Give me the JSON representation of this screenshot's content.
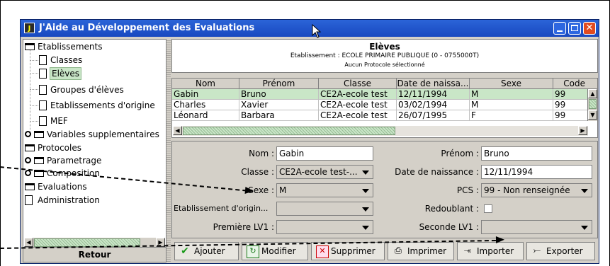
{
  "window": {
    "title": "J'Aide au Développement des Evaluations",
    "app_icon_glyph": "J"
  },
  "tree": {
    "items": [
      {
        "label": "Etablissements",
        "icon": "folder-icon"
      },
      {
        "label": "Classes",
        "icon": "document-icon"
      },
      {
        "label": "Elèves",
        "icon": "document-icon"
      },
      {
        "label": "Groupes d'élèves",
        "icon": "document-icon"
      },
      {
        "label": "Etablissements d'origine",
        "icon": "document-icon"
      },
      {
        "label": "MEF",
        "icon": "document-icon"
      },
      {
        "label": "Variables supplementaires",
        "icon": "folder-icon"
      },
      {
        "label": "Protocoles",
        "icon": "folder-icon"
      },
      {
        "label": "Parametrage",
        "icon": "folder-icon"
      },
      {
        "label": "Composition",
        "icon": "folder-icon"
      },
      {
        "label": "Evaluations",
        "icon": "folder-icon"
      },
      {
        "label": "Administration",
        "icon": "document-icon"
      }
    ],
    "selected": "Elèves"
  },
  "retour_label": "Retour",
  "header": {
    "title": "Elèves",
    "etablissement": "Etablissement : ECOLE PRIMAIRE PUBLIQUE  (0 - 0755000T)",
    "protocole": "Aucun Protocole sélectionné"
  },
  "table": {
    "columns": [
      "Nom",
      "Prénom",
      "Classe",
      "Date de naissa...",
      "Sexe",
      "Code"
    ],
    "rows": [
      [
        "Gabin",
        "Bruno",
        "CE2A-ecole test",
        "12/11/1994",
        "M",
        "99"
      ],
      [
        "Charles",
        "Xavier",
        "CE2A-ecole test",
        "03/02/1994",
        "M",
        "99"
      ],
      [
        "Léonard",
        "Barbara",
        "CE2A-ecole test",
        "26/07/1995",
        "F",
        "99"
      ]
    ],
    "selected_row": 0
  },
  "form": {
    "nom_label": "Nom :",
    "nom_value": "Gabin",
    "prenom_label": "Prénom :",
    "prenom_value": "Bruno",
    "classe_label": "Classe :",
    "classe_value": "CE2A-ecole test-...",
    "date_label": "Date de naissance :",
    "date_value": "12/11/1994",
    "sexe_label": "Sexe :",
    "sexe_value": "M",
    "pcs_label": "PCS :",
    "pcs_value": "99 - Non renseignée",
    "etab_origine_label": "Etablissement d'origin...",
    "etab_origine_value": "",
    "redoublant_label": "Redoublant :",
    "premiere_lv1_label": "Première LV1 :",
    "premiere_lv1_value": "",
    "seconde_lv1_label": "Seconde LV1 :",
    "seconde_lv1_value": ""
  },
  "toolbar": {
    "ajouter": "Ajouter",
    "modifier": "Modifier",
    "supprimer": "Supprimer",
    "imprimer": "Imprimer",
    "importer": "Importer",
    "exporter": "Exporter"
  },
  "colors": {
    "title_bar": "#2b64d8",
    "selection_green": "#c9e6c7",
    "window_bg": "#d4d0c8"
  }
}
